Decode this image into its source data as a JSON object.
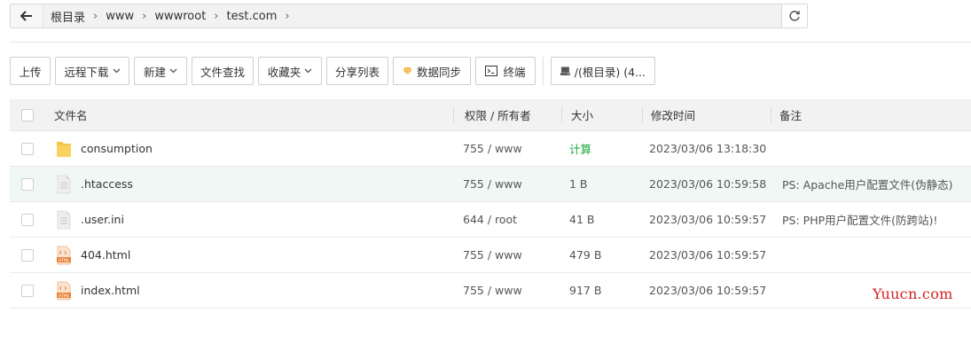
{
  "breadcrumb": [
    "根目录",
    "www",
    "wwwroot",
    "test.com"
  ],
  "toolbar": {
    "upload": "上传",
    "remote_download": "远程下载",
    "new": "新建",
    "file_search": "文件查找",
    "favorites": "收藏夹",
    "share_list": "分享列表",
    "data_sync": "数据同步",
    "terminal": "终端",
    "disk": "/(根目录) (4..."
  },
  "columns": {
    "name": "文件名",
    "perm": "权限 / 所有者",
    "size": "大小",
    "mtime": "修改时间",
    "note": "备注"
  },
  "files": [
    {
      "name": "consumption",
      "perm": "755 / www",
      "size": "计算",
      "mtime": "2023/03/06 13:18:30",
      "note": "",
      "icon": "folder-icon"
    },
    {
      "name": ".htaccess",
      "perm": "755 / www",
      "size": "1 B",
      "mtime": "2023/03/06 10:59:58",
      "note": "PS: Apache用户配置文件(伪静态)",
      "icon": "file-icon"
    },
    {
      "name": ".user.ini",
      "perm": "644 / root",
      "size": "41 B",
      "mtime": "2023/03/06 10:59:57",
      "note": "PS: PHP用户配置文件(防跨站)!",
      "icon": "file-icon"
    },
    {
      "name": "404.html",
      "perm": "755 / www",
      "size": "479 B",
      "mtime": "2023/03/06 10:59:57",
      "note": "",
      "icon": "html-file-icon"
    },
    {
      "name": "index.html",
      "perm": "755 / www",
      "size": "917 B",
      "mtime": "2023/03/06 10:59:57",
      "note": "",
      "icon": "html-file-icon"
    }
  ],
  "icon_label_html": "HTML",
  "watermark": "Yuucn.com",
  "colors": {
    "accent_green": "#20a53a",
    "highlight_row": "#f0f8f6",
    "watermark": "#d42020",
    "folder": "#f6c343",
    "html_icon": "#e8833a"
  }
}
